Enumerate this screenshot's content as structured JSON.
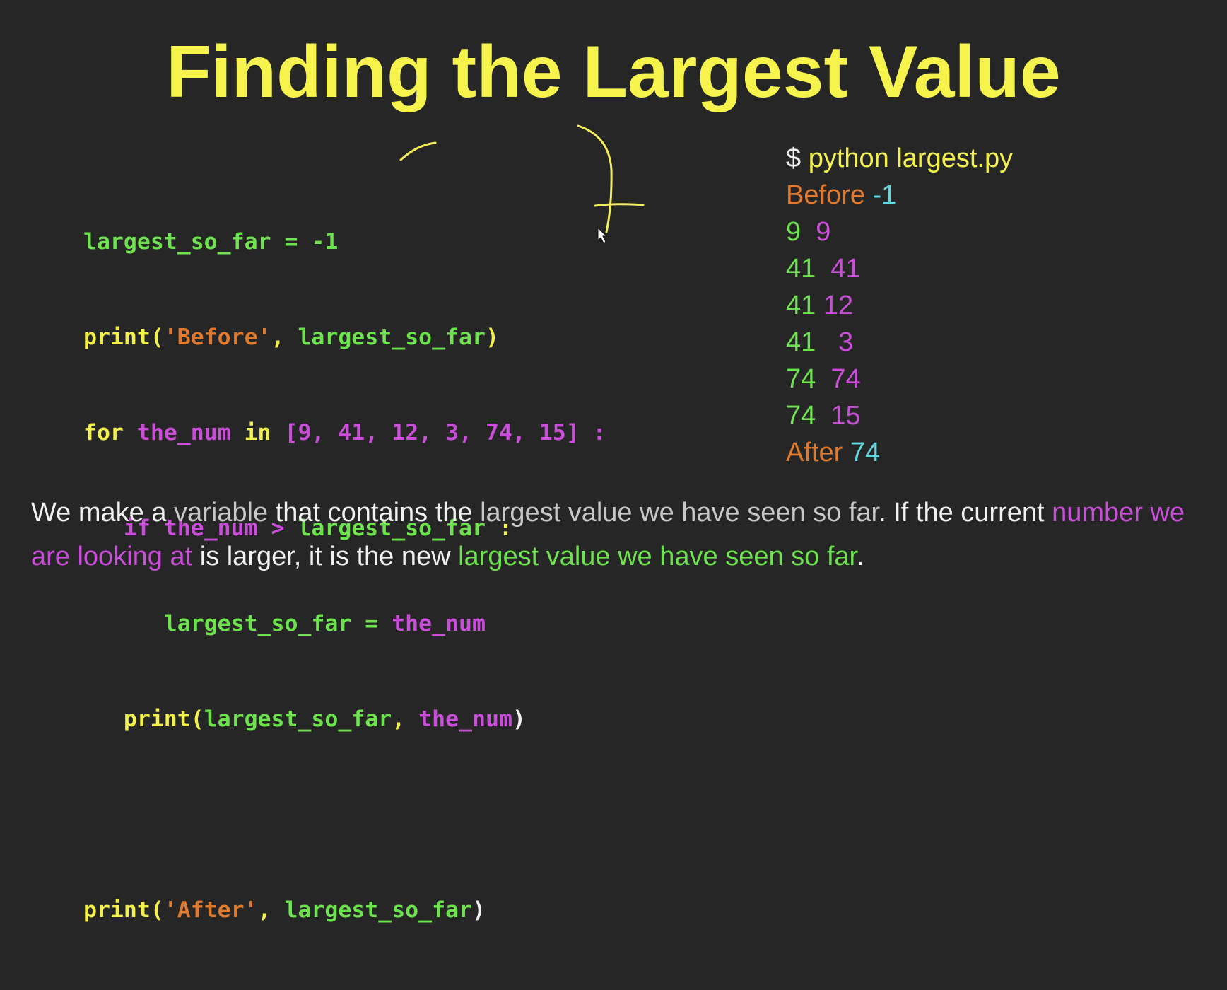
{
  "title": "Finding the Largest Value",
  "code": {
    "line1": {
      "a": "largest_so_far = -1"
    },
    "line2": {
      "a": "print(",
      "b": "'Before'",
      "c": ", ",
      "d": "largest_so_far",
      "e": ")"
    },
    "line3": {
      "a": "for ",
      "b": "the_num",
      "c": " in ",
      "d": "[9, 41, 12, 3, 74, 15]",
      "e": " :"
    },
    "line4": {
      "a": "if ",
      "b": "the_num > ",
      "c": "largest_so_far",
      "d": " :"
    },
    "line5": {
      "a": "largest_so_far",
      "b": " = ",
      "c": "the_num"
    },
    "line6": {
      "a": "print(",
      "b": "largest_so_far",
      "c": ", ",
      "d": "the_num",
      "e": ")"
    },
    "line8": {
      "a": "print(",
      "b": "'After'",
      "c": ", ",
      "d": "largest_so_far",
      "e": ")"
    }
  },
  "output": {
    "command": {
      "prompt": "$ ",
      "text": "python largest.py"
    },
    "before": {
      "label": "Before",
      "value": "-1"
    },
    "rows": [
      {
        "largest": "9",
        "num": "9"
      },
      {
        "largest": "41",
        "num": "41"
      },
      {
        "largest": "41",
        "num": "12"
      },
      {
        "largest": "41",
        "num": "3"
      },
      {
        "largest": "74",
        "num": "74"
      },
      {
        "largest": "74",
        "num": "15"
      }
    ],
    "after": {
      "label": "After",
      "value": "74"
    }
  },
  "caption": {
    "p1": "We make a ",
    "p2": "variable",
    "p3": " that contains the ",
    "p4": "largest value we have seen so far",
    "p5": ". If the current ",
    "p6": "number we are looking at",
    "p7": " is larger, it is the new ",
    "p8": "largest value we have seen so far",
    "p9": "."
  },
  "colors": {
    "background": "#262626",
    "title": "#f6f44c",
    "keyword_yellow": "#f2f04a",
    "variable_green": "#6fe24f",
    "loop_magenta": "#c94fd8",
    "string_orange": "#e07a2e",
    "number_cyan": "#5fd8e0",
    "ink": "#f2ee5a"
  },
  "icons": {
    "annotation": "pen-annotation-icon",
    "cursor": "mouse-cursor-icon"
  }
}
